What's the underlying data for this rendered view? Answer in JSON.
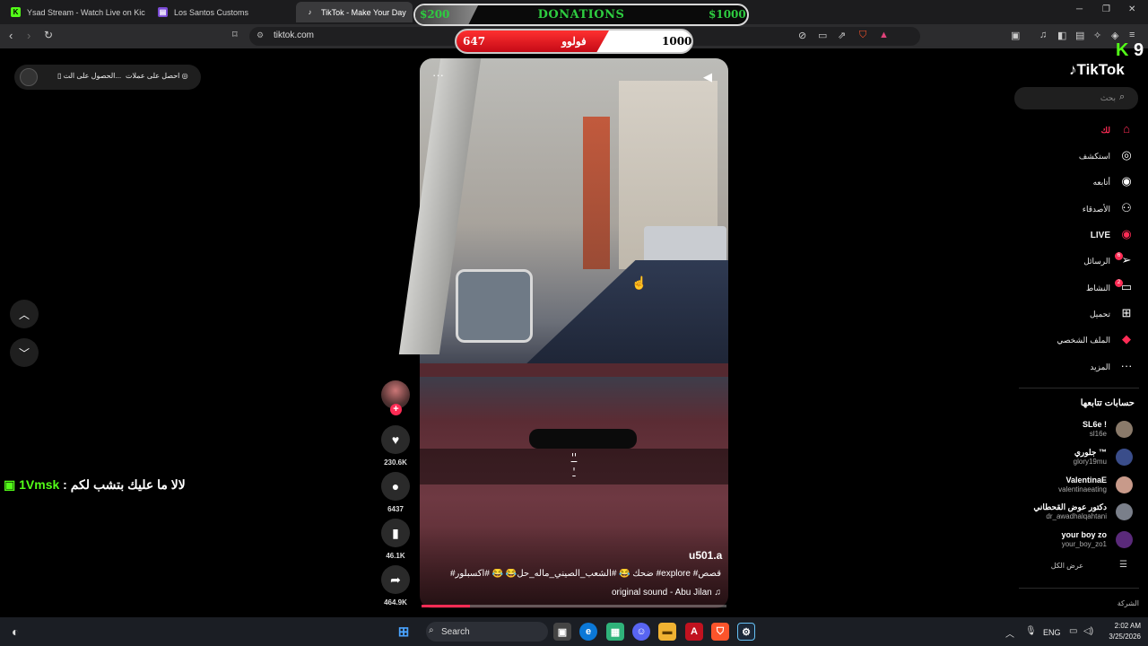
{
  "browser": {
    "tabs": [
      {
        "label": "Ysad Stream - Watch Live on Kick",
        "icon": "kick-icon"
      },
      {
        "label": "Los Santos Customs",
        "icon": "tab-page-icon"
      },
      {
        "label": "TikTok - Make Your Day",
        "icon": "tiktok-icon"
      }
    ],
    "url": "tiktok.com"
  },
  "donations": {
    "left_amount": "$200",
    "title": "DONATIONS",
    "right_amount": "$1000",
    "bar_left": "647",
    "bar_label": "فولوو",
    "bar_right": "1000",
    "progress": 0.647,
    "colors": {
      "green": "#2ecc40",
      "red": "#e41e26"
    }
  },
  "promo": {
    "item_a": "احصل على عملات",
    "item_b": "الحصول على الت..."
  },
  "chat": {
    "username": "1Vmsk",
    "separator": ":",
    "message": "لالا ما عليك بتشب لكم"
  },
  "video": {
    "overlay_text_line1": "ـٰٰٰٰٰٰٰٰٰٰٰٰٰٰٰٰٰٰٰٰٰٰٰٰٰٰٰٰٰٰٰٰٰٰٰٰٰٰٰٰٰٰٰٰٰـٰٰٰٰٰٰٰٰٰٰٰٰٰٰٰٰٰٰٰٰٰٰٰٰٰٰٰٰٰٰٰٰ",
    "overlay_text_line2": "ـٰٰٰٰٰٰٰٰٰٰٰٰ",
    "username": "u501.a",
    "description": "#ضحك 😂 #الشعب_الصيني_ماله_حل😂 😂 #اكسبلور #explore #قصص",
    "sound": "original sound - Abu Jilan",
    "progress": 0.16
  },
  "actions": {
    "likes": "230.6K",
    "comments": "6437",
    "saves": "46.1K",
    "shares": "464.9K"
  },
  "tiktok": {
    "logo": "TikTok",
    "search_placeholder": "بحث",
    "nav": [
      {
        "label": "لك",
        "icon": "home-icon"
      },
      {
        "label": "استكشف",
        "icon": "compass-icon"
      },
      {
        "label": "أتابعه",
        "icon": "following-avatar-icon"
      },
      {
        "label": "الأصدقاء",
        "icon": "friends-icon"
      },
      {
        "label": "LIVE",
        "icon": "live-icon"
      },
      {
        "label": "الرسائل",
        "icon": "messages-icon",
        "badge": "6"
      },
      {
        "label": "النشاط",
        "icon": "activity-icon",
        "badge": "2"
      },
      {
        "label": "تحميل",
        "icon": "upload-icon"
      },
      {
        "label": "الملف الشخصي",
        "icon": "profile-icon"
      },
      {
        "label": "المزيد",
        "icon": "more-icon"
      }
    ],
    "following_title": "حسابات تتابعها",
    "accounts": [
      {
        "name": "SL6e !",
        "handle": "sl16e"
      },
      {
        "name": "جلوري ™",
        "handle": "glory19mu"
      },
      {
        "name": "ValentinaE",
        "handle": "valentinaeating"
      },
      {
        "name": "دكتور عوض القحطاني",
        "handle": "dr_awadhalqahtani"
      },
      {
        "name": "your boy zo",
        "handle": "your_boy_zo1"
      }
    ],
    "see_all": "عرض الكل",
    "company": "الشركة"
  },
  "kick_badge": {
    "letter": "K",
    "number": "9",
    "color": "#53fc18"
  },
  "taskbar": {
    "search_label": "Search",
    "lang": "ENG",
    "time": "2:02 AM",
    "date": "3/25/2026"
  }
}
